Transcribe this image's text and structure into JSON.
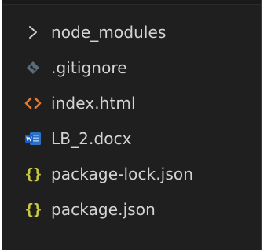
{
  "explorer": {
    "items": [
      {
        "label": "node_modules",
        "icon": "chevron-right-icon",
        "color": "#cccccc"
      },
      {
        "label": ".gitignore",
        "icon": "git-diamond-icon",
        "color": "#5a6b7a"
      },
      {
        "label": "index.html",
        "icon": "html-brackets-icon",
        "color": "#e37933"
      },
      {
        "label": "LB_2.docx",
        "icon": "word-document-icon",
        "color": "#2b72c5"
      },
      {
        "label": "package-lock.json",
        "icon": "json-braces-icon",
        "color": "#cbcb41",
        "glyph": "{}"
      },
      {
        "label": "package.json",
        "icon": "json-braces-icon",
        "color": "#cbcb41",
        "glyph": "{}"
      }
    ]
  }
}
